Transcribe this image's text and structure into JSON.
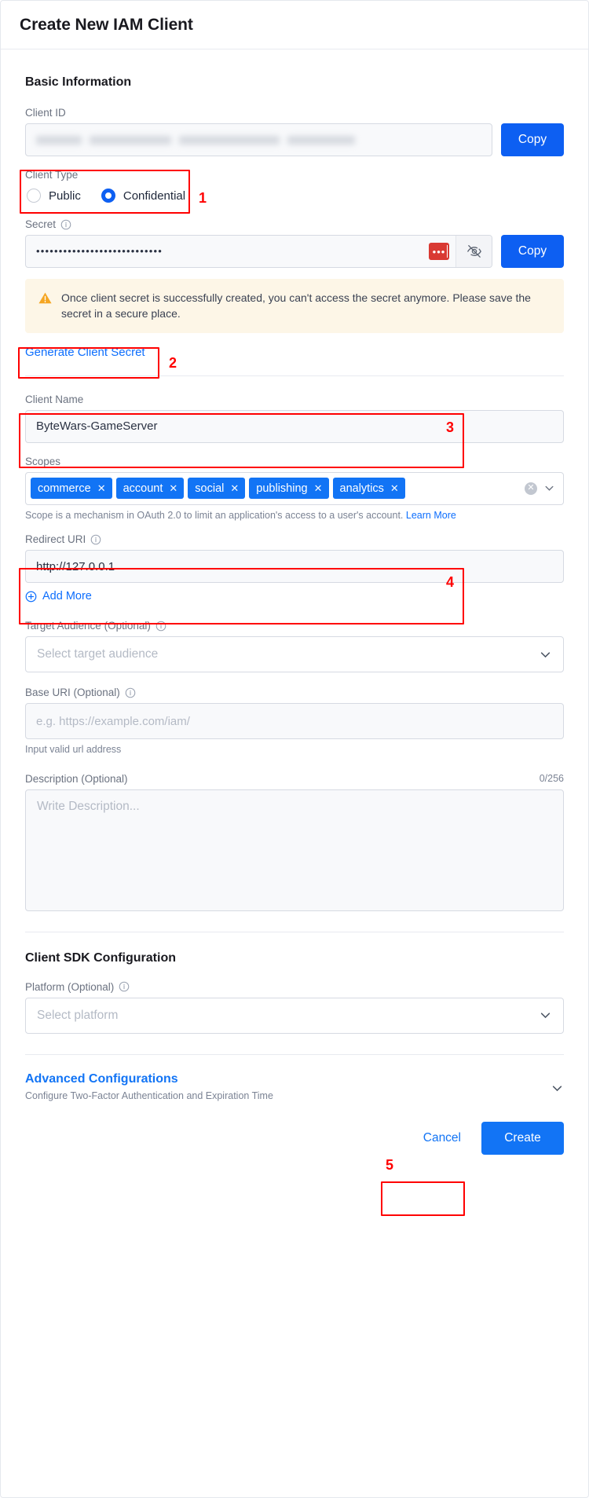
{
  "header": {
    "title": "Create New IAM Client"
  },
  "sections": {
    "basic_information": "Basic Information",
    "client_sdk_configuration": "Client SDK Configuration"
  },
  "client_id": {
    "label": "Client ID",
    "value": "",
    "copy_label": "Copy"
  },
  "client_type": {
    "label": "Client Type",
    "options": [
      {
        "label": "Public",
        "selected": false
      },
      {
        "label": "Confidential",
        "selected": true
      }
    ]
  },
  "secret": {
    "label": "Secret",
    "value": "••••••••••••••••••••••••••••",
    "badge": "•••",
    "copy_label": "Copy",
    "warning": "Once client secret is successfully created, you can't access the secret anymore. Please save the secret in a secure place.",
    "generate_label": "Generate Client Secret"
  },
  "client_name": {
    "label": "Client Name",
    "value": "ByteWars-GameServer"
  },
  "scopes": {
    "label": "Scopes",
    "tags": [
      "commerce",
      "account",
      "social",
      "publishing",
      "analytics"
    ],
    "help_text": "Scope is a mechanism in OAuth 2.0 to limit an application's access to a user's account.",
    "help_link": "Learn More"
  },
  "redirect_uri": {
    "label": "Redirect URI",
    "value": "http://127.0.0.1",
    "add_more_label": "Add More"
  },
  "target_audience": {
    "label": "Target Audience (Optional)",
    "placeholder": "Select target audience",
    "value": ""
  },
  "base_uri": {
    "label": "Base URI (Optional)",
    "placeholder": "e.g. https://example.com/iam/",
    "value": "",
    "help_text": "Input valid url address"
  },
  "description": {
    "label": "Description (Optional)",
    "counter": "0/256",
    "placeholder": "Write Description...",
    "value": ""
  },
  "platform": {
    "label": "Platform (Optional)",
    "placeholder": "Select platform",
    "value": ""
  },
  "advanced": {
    "title": "Advanced Configurations",
    "subtitle": "Configure Two-Factor Authentication and Expiration Time"
  },
  "footer": {
    "cancel_label": "Cancel",
    "create_label": "Create"
  },
  "annotations": {
    "step1": "1",
    "step2": "2",
    "step3": "3",
    "step4": "4",
    "step5": "5"
  },
  "colors": {
    "primary_blue": "#1274f5",
    "copy_blue": "#0d5ff2",
    "link_blue": "#0d6efd",
    "annotation_red": "#ff0000",
    "warning_bg": "#fdf6e7",
    "warning_icon": "#f5a623",
    "secret_badge_red": "#d93a33"
  }
}
